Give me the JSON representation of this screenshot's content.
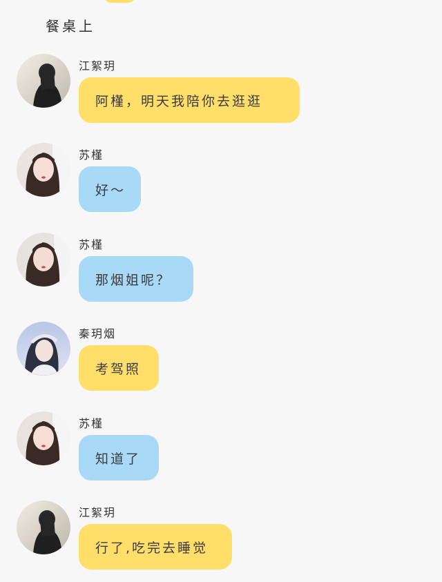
{
  "scene": {
    "title": "餐桌上"
  },
  "messages": [
    {
      "sender": "江絮玥",
      "text": "阿槿，明天我陪你去逛逛",
      "bubble_color": "yellow",
      "avatar": "jiang-xuyue-avatar"
    },
    {
      "sender": "苏槿",
      "text": "好～",
      "bubble_color": "blue",
      "avatar": "su-jin-avatar"
    },
    {
      "sender": "苏槿",
      "text": "那烟姐呢？",
      "bubble_color": "blue",
      "avatar": "su-jin-avatar"
    },
    {
      "sender": "秦玥烟",
      "text": "考驾照",
      "bubble_color": "yellow",
      "avatar": "qin-yueyan-avatar"
    },
    {
      "sender": "苏槿",
      "text": "知道了",
      "bubble_color": "blue",
      "avatar": "su-jin-avatar"
    },
    {
      "sender": "江絮玥",
      "text": "行了,吃完去睡觉",
      "bubble_color": "yellow",
      "avatar": "jiang-xuyue-avatar"
    }
  ],
  "colors": {
    "background": "#f7f7f7",
    "yellow_bubble": "#ffdf6a",
    "blue_bubble": "#a8daf8"
  }
}
